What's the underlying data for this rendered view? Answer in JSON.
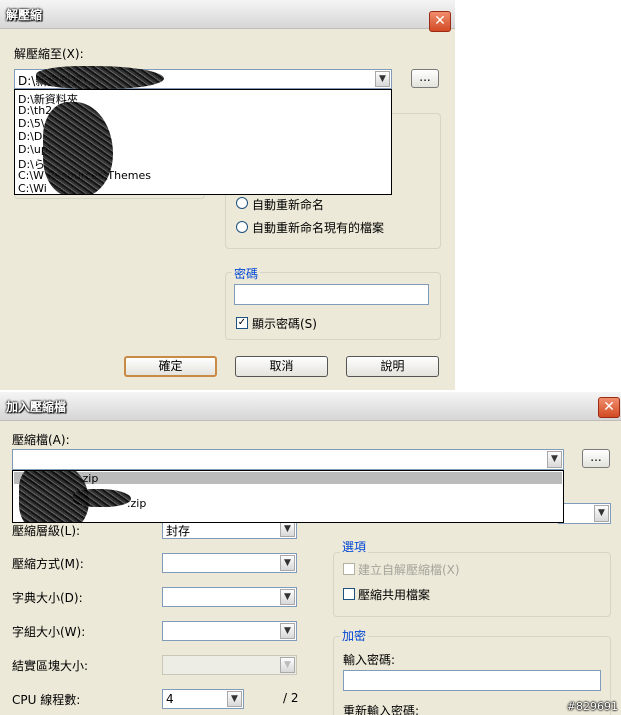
{
  "extract_dialog": {
    "title": "解壓縮",
    "close": "✕",
    "extract_to_label": "解壓縮至(X):",
    "path_value": "D:\\新資料夾\\...",
    "browse_label": "...",
    "dropdown_items": [
      "D:\\新資料夾",
      "D:\\th2",
      "D:\\5\\",
      "D:\\D",
      "D:\\up\\",
      "D:\\ら",
      "C:\\W                   Resources\\Themes",
      "C:\\Wi"
    ],
    "rename_auto": "自動重新命名",
    "rename_existing": "自動重新命名現有的檔案",
    "password_group": "密碼",
    "show_password": "顯示密碼(S)",
    "show_password_checked": "✓",
    "ok": "確定",
    "cancel": "取消",
    "help": "說明"
  },
  "add_dialog": {
    "title": "加入壓縮檔",
    "close": "✕",
    "archive_label": "壓縮檔(A):",
    "browse_label": "...",
    "dropdown_items": [
      ".zip",
      ".zip"
    ],
    "level_label": "壓縮層級(L):",
    "level_value": "封存",
    "method_label": "壓縮方式(M):",
    "dict_label": "字典大小(D):",
    "word_label": "字組大小(W):",
    "solid_label": "結實區塊大小:",
    "cpu_label": "CPU 線程數:",
    "cpu_value": "4",
    "cpu_max": "/ 2",
    "options_group": "選項",
    "sfx_label": "建立自解壓縮檔(X)",
    "shared_label": "壓縮共用檔案",
    "encrypt_group": "加密",
    "enter_password": "輸入密碼:",
    "reenter_password": "重新輸入密碼:"
  },
  "watermark": "#829691"
}
